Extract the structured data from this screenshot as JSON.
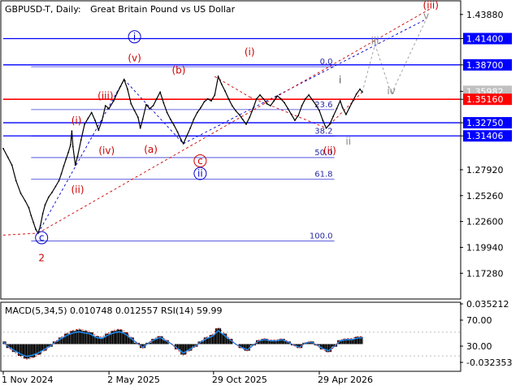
{
  "header": {
    "symbol_label": "GBPUSD-T, Daily:",
    "description": "Great Britain Pound vs US Dollar"
  },
  "chart_data": [
    {
      "type": "line",
      "title": "GBPUSD-T, Daily:  Great Britain Pound vs US Dollar",
      "ylim": [
        1.148,
        1.452
      ],
      "y_ticks": [
        1.4388,
        1.414,
        1.387,
        1.3598,
        1.3516,
        1.3275,
        1.314,
        1.2792,
        1.2526,
        1.226,
        1.1994,
        1.1728
      ],
      "y_tick_labels": [
        "1.43880",
        "1.41400",
        "1.38700",
        "1.35982",
        "1.35160",
        "1.32750",
        "1.31406",
        "1.27920",
        "1.25260",
        "1.22600",
        "1.19940",
        "1.17280"
      ],
      "current_price": 1.3598,
      "current_price_label": "1.35982",
      "x_tick_labels": [
        {
          "label": "1 Nov 2024",
          "day": 0
        },
        {
          "label": "2 May 2025",
          "day": 182
        },
        {
          "label": "29 Oct 2025",
          "day": 362
        },
        {
          "label": "29 Apr 2026",
          "day": 544
        }
      ],
      "x_range_days": [
        0,
        786
      ],
      "grid": false,
      "series": [
        {
          "values_by_day": [
            [
              0,
              1.301
            ],
            [
              8,
              1.292
            ],
            [
              15,
              1.284
            ],
            [
              22,
              1.268
            ],
            [
              30,
              1.255
            ],
            [
              38,
              1.247
            ],
            [
              44,
              1.24
            ],
            [
              48,
              1.232
            ],
            [
              52,
              1.225
            ],
            [
              56,
              1.218
            ],
            [
              60,
              1.214
            ],
            [
              64,
              1.222
            ],
            [
              68,
              1.234
            ],
            [
              72,
              1.243
            ],
            [
              78,
              1.251
            ],
            [
              84,
              1.256
            ],
            [
              90,
              1.262
            ],
            [
              96,
              1.268
            ],
            [
              100,
              1.275
            ],
            [
              104,
              1.283
            ],
            [
              108,
              1.29
            ],
            [
              112,
              1.297
            ],
            [
              116,
              1.305
            ],
            [
              118,
              1.319
            ],
            [
              120,
              1.303
            ],
            [
              124,
              1.284
            ],
            [
              128,
              1.293
            ],
            [
              134,
              1.31
            ],
            [
              140,
              1.326
            ],
            [
              146,
              1.332
            ],
            [
              152,
              1.338
            ],
            [
              158,
              1.33
            ],
            [
              164,
              1.32
            ],
            [
              170,
              1.33
            ],
            [
              176,
              1.345
            ],
            [
              182,
              1.342
            ],
            [
              190,
              1.35
            ],
            [
              196,
              1.358
            ],
            [
              202,
              1.365
            ],
            [
              208,
              1.372
            ],
            [
              214,
              1.362
            ],
            [
              220,
              1.347
            ],
            [
              226,
              1.34
            ],
            [
              232,
              1.333
            ],
            [
              236,
              1.322
            ],
            [
              240,
              1.331
            ],
            [
              246,
              1.346
            ],
            [
              252,
              1.342
            ],
            [
              258,
              1.345
            ],
            [
              264,
              1.352
            ],
            [
              270,
              1.359
            ],
            [
              276,
              1.348
            ],
            [
              282,
              1.338
            ],
            [
              288,
              1.331
            ],
            [
              294,
              1.325
            ],
            [
              300,
              1.318
            ],
            [
              306,
              1.31
            ],
            [
              310,
              1.306
            ],
            [
              316,
              1.314
            ],
            [
              322,
              1.322
            ],
            [
              328,
              1.331
            ],
            [
              334,
              1.338
            ],
            [
              340,
              1.343
            ],
            [
              346,
              1.349
            ],
            [
              352,
              1.352
            ],
            [
              358,
              1.35
            ],
            [
              364,
              1.356
            ],
            [
              370,
              1.375
            ],
            [
              376,
              1.367
            ],
            [
              382,
              1.36
            ],
            [
              388,
              1.352
            ],
            [
              394,
              1.345
            ],
            [
              400,
              1.34
            ],
            [
              406,
              1.336
            ],
            [
              412,
              1.331
            ],
            [
              418,
              1.326
            ],
            [
              424,
              1.333
            ],
            [
              430,
              1.342
            ],
            [
              436,
              1.352
            ],
            [
              442,
              1.356
            ],
            [
              448,
              1.352
            ],
            [
              454,
              1.347
            ],
            [
              460,
              1.345
            ],
            [
              466,
              1.35
            ],
            [
              472,
              1.355
            ],
            [
              478,
              1.352
            ],
            [
              484,
              1.348
            ],
            [
              490,
              1.342
            ],
            [
              496,
              1.336
            ],
            [
              502,
              1.33
            ],
            [
              508,
              1.335
            ],
            [
              514,
              1.345
            ],
            [
              520,
              1.352
            ],
            [
              526,
              1.356
            ],
            [
              532,
              1.351
            ],
            [
              538,
              1.346
            ],
            [
              544,
              1.34
            ],
            [
              550,
              1.33
            ],
            [
              556,
              1.322
            ],
            [
              562,
              1.326
            ],
            [
              568,
              1.334
            ],
            [
              574,
              1.342
            ],
            [
              580,
              1.35
            ],
            [
              584,
              1.343
            ],
            [
              590,
              1.336
            ],
            [
              596,
              1.343
            ],
            [
              602,
              1.35
            ],
            [
              608,
              1.357
            ],
            [
              614,
              1.362
            ],
            [
              618,
              1.359
            ]
          ]
        }
      ],
      "horizontal_levels": [
        {
          "label": "1.41400",
          "value": 1.414,
          "color": "#0000ff",
          "style": "solid"
        },
        {
          "label": "1.38700",
          "value": 1.387,
          "color": "#0000ff",
          "style": "solid"
        },
        {
          "label": "1.35160",
          "value": 1.3516,
          "color": "#ff0000",
          "style": "solid"
        },
        {
          "label": "1.32750",
          "value": 1.3275,
          "color": "#0000ff",
          "style": "solid"
        },
        {
          "label": "1.31406",
          "value": 1.314,
          "color": "#0000ff",
          "style": "solid"
        }
      ],
      "fibonacci_levels": [
        {
          "label": "0.0",
          "value": 1.3851
        },
        {
          "label": "23.6",
          "value": 1.341
        },
        {
          "label": "38.2",
          "value": 1.3137
        },
        {
          "label": "50.0",
          "value": 1.2917
        },
        {
          "label": "61.8",
          "value": 1.2696
        },
        {
          "label": "100.0",
          "value": 1.2059
        }
      ],
      "fibonacci_range_days": [
        48,
        570
      ],
      "wave_labels": [
        {
          "text": "2",
          "day": 66,
          "value": 1.185,
          "color": "#cc0000",
          "circled": false
        },
        {
          "text": "c",
          "day": 66,
          "value": 1.206,
          "color": "#0000cc",
          "circled": true
        },
        {
          "text": "(ii)",
          "day": 128,
          "value": 1.2552,
          "color": "#cc0000",
          "circled": false
        },
        {
          "text": "(i)",
          "day": 126,
          "value": 1.3262,
          "color": "#cc0000",
          "circled": false
        },
        {
          "text": "(iii)",
          "day": 176,
          "value": 1.3516,
          "color": "#cc0000",
          "circled": false
        },
        {
          "text": "(iv)",
          "day": 178,
          "value": 1.2955,
          "color": "#cc0000",
          "circled": false
        },
        {
          "text": "i",
          "day": 226,
          "value": 1.4125,
          "color": "#0000cc",
          "circled": true
        },
        {
          "text": "(v)",
          "day": 226,
          "value": 1.3905,
          "color": "#cc0000",
          "circled": false
        },
        {
          "text": "(a)",
          "day": 254,
          "value": 1.2965,
          "color": "#cc0000",
          "circled": false
        },
        {
          "text": "(b)",
          "day": 302,
          "value": 1.378,
          "color": "#cc0000",
          "circled": false
        },
        {
          "text": "c",
          "day": 339,
          "value": 1.285,
          "color": "#cc0000",
          "circled": true
        },
        {
          "text": "ii",
          "day": 339,
          "value": 1.272,
          "color": "#0000cc",
          "circled": true
        },
        {
          "text": "(i)",
          "day": 424,
          "value": 1.397,
          "color": "#cc0000",
          "circled": false
        },
        {
          "text": "(ii)",
          "day": 562,
          "value": 1.2955,
          "color": "#cc0000",
          "circled": false
        },
        {
          "text": "i",
          "day": 580,
          "value": 1.368,
          "color": "#555555",
          "circled": false
        },
        {
          "text": "ii",
          "day": 594,
          "value": 1.305,
          "color": "#888888",
          "circled": false
        },
        {
          "text": "iii",
          "day": 640,
          "value": 1.408,
          "color": "#888888",
          "circled": false
        },
        {
          "text": "iv",
          "day": 668,
          "value": 1.357,
          "color": "#888888",
          "circled": false
        },
        {
          "text": "v",
          "day": 728,
          "value": 1.434,
          "color": "#888888",
          "circled": false
        },
        {
          "text": "(iii)",
          "day": 736,
          "value": 1.445,
          "color": "#cc0000",
          "circled": false
        }
      ]
    },
    {
      "type": "line",
      "title": "MACD(5,34,5) 0.010748 0.012557 RSI(14) 59.99",
      "ylim": [
        -0.039,
        0.039
      ],
      "y_tick_labels": [
        "0.035212",
        "70.00",
        "30.00",
        "-0.032353"
      ],
      "series": [
        {
          "name": "MACD(5,34,5)",
          "values_by_day": [
            [
              0,
              0.004
            ],
            [
              10,
              -0.006
            ],
            [
              20,
              -0.012
            ],
            [
              30,
              -0.018
            ],
            [
              40,
              -0.022
            ],
            [
              50,
              -0.02
            ],
            [
              60,
              -0.016
            ],
            [
              70,
              -0.01
            ],
            [
              80,
              -0.004
            ],
            [
              90,
              0.004
            ],
            [
              100,
              0.01
            ],
            [
              110,
              0.016
            ],
            [
              120,
              0.02
            ],
            [
              130,
              0.022
            ],
            [
              140,
              0.02
            ],
            [
              150,
              0.018
            ],
            [
              160,
              0.012
            ],
            [
              170,
              0.01
            ],
            [
              180,
              0.016
            ],
            [
              190,
              0.02
            ],
            [
              200,
              0.022
            ],
            [
              210,
              0.018
            ],
            [
              220,
              0.01
            ],
            [
              230,
              0.002
            ],
            [
              240,
              -0.006
            ],
            [
              250,
              0.002
            ],
            [
              260,
              0.008
            ],
            [
              270,
              0.012
            ],
            [
              280,
              0.006
            ],
            [
              290,
              0.0
            ],
            [
              300,
              -0.008
            ],
            [
              310,
              -0.016
            ],
            [
              320,
              -0.01
            ],
            [
              330,
              -0.004
            ],
            [
              340,
              0.004
            ],
            [
              350,
              0.01
            ],
            [
              360,
              0.014
            ],
            [
              370,
              0.024
            ],
            [
              380,
              0.016
            ],
            [
              390,
              0.008
            ],
            [
              400,
              0.0
            ],
            [
              410,
              -0.006
            ],
            [
              420,
              -0.01
            ],
            [
              430,
              -0.002
            ],
            [
              440,
              0.006
            ],
            [
              450,
              0.008
            ],
            [
              460,
              0.006
            ],
            [
              470,
              0.006
            ],
            [
              480,
              0.008
            ],
            [
              490,
              0.004
            ],
            [
              500,
              -0.002
            ],
            [
              510,
              -0.006
            ],
            [
              520,
              0.002
            ],
            [
              530,
              0.004
            ],
            [
              540,
              -0.002
            ],
            [
              550,
              -0.008
            ],
            [
              560,
              -0.012
            ],
            [
              570,
              -0.004
            ],
            [
              580,
              0.006
            ],
            [
              590,
              0.008
            ],
            [
              600,
              0.008
            ],
            [
              610,
              0.011
            ],
            [
              618,
              0.011
            ]
          ]
        }
      ]
    }
  ],
  "colors": {
    "price_line": "#000000",
    "level_blue": "#0000ff",
    "level_red": "#ff0000",
    "wave_red": "#cc0000",
    "wave_blue": "#0000cc",
    "projection_gray": "#999999",
    "current_price_box": "#c0c0c0",
    "macd_histogram": "#000000",
    "macd_signal": "#1e90ff"
  }
}
